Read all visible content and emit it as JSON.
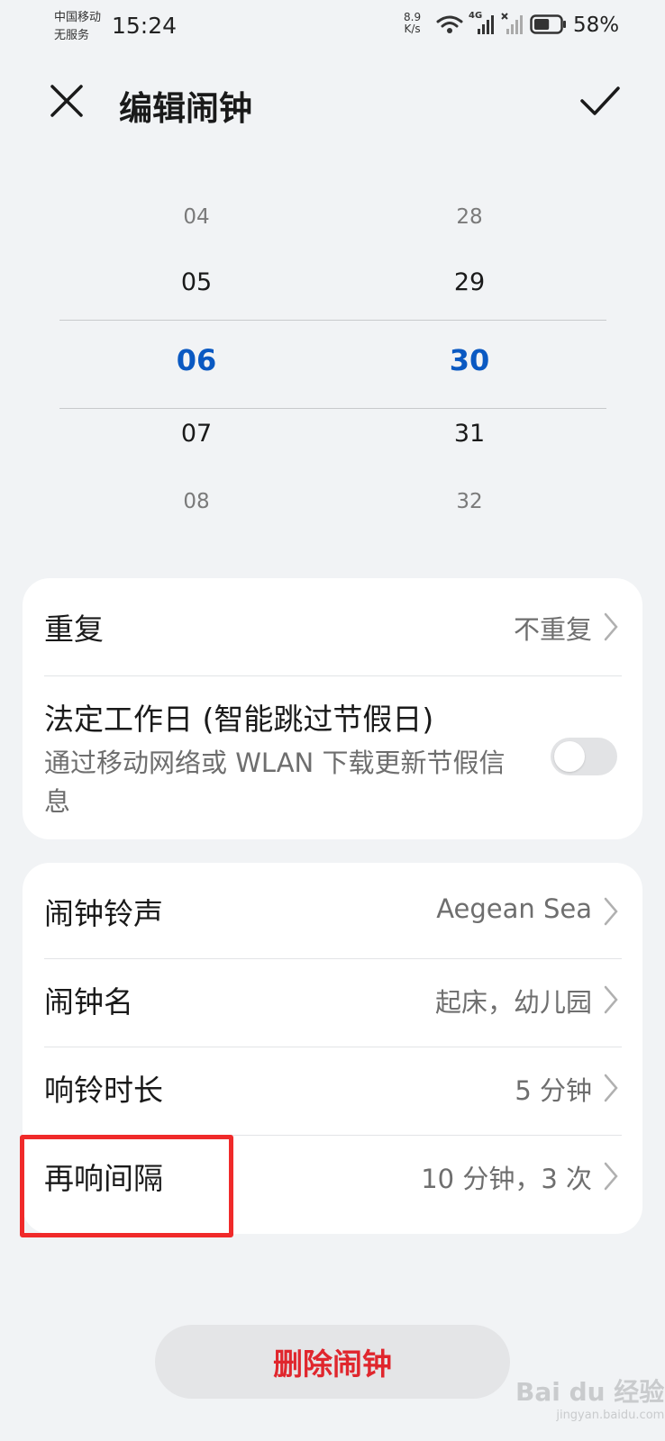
{
  "status_bar": {
    "carrier_line1": "中国移动",
    "carrier_line2": "无服务",
    "time": "15:24",
    "speed_value": "8.9",
    "speed_unit": "K/s",
    "network_type": "4G",
    "battery_percent": "58%",
    "battery_level": 0.58
  },
  "header": {
    "title": "编辑闹钟"
  },
  "time_picker": {
    "hours": [
      "04",
      "05",
      "06",
      "07",
      "08"
    ],
    "minutes": [
      "28",
      "29",
      "30",
      "31",
      "32"
    ],
    "selected_hour": "06",
    "selected_minute": "30",
    "accent_color": "#0a59c2"
  },
  "repeat_card": {
    "repeat_label": "重复",
    "repeat_value": "不重复",
    "workday_title": "法定工作日 (智能跳过节假日)",
    "workday_subtitle": "通过移动网络或 WLAN 下载更新节假信息",
    "workday_enabled": false
  },
  "settings_card": {
    "ringtone_label": "闹钟铃声",
    "ringtone_value": "Aegean Sea",
    "name_label": "闹钟名",
    "name_value": "起床，幼儿园",
    "duration_label": "响铃时长",
    "duration_value": "5 分钟",
    "snooze_label": "再响间隔",
    "snooze_value": "10 分钟，3 次"
  },
  "delete_button": {
    "label": "删除闹钟",
    "color": "#e0262d"
  },
  "highlight_color": "#f02a2a",
  "watermark": {
    "text": "Bai du 经验",
    "sub": "jingyan.baidu.com"
  }
}
